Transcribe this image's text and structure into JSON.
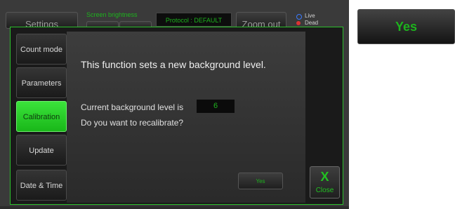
{
  "background": {
    "settings_label": "Settings",
    "brightness_label": "Screen brightness",
    "protocol_label": "Protocol : DEFAULT",
    "zoom_out_label": "Zoom out",
    "live_label": "Live",
    "dead_label": "Dead"
  },
  "sidebar": {
    "items": [
      {
        "label": "Count mode",
        "active": false
      },
      {
        "label": "Parameters",
        "active": false
      },
      {
        "label": "Calibration",
        "active": true
      },
      {
        "label": "Update",
        "active": false
      },
      {
        "label": "Date & Time",
        "active": false
      }
    ]
  },
  "dialog": {
    "heading": "This function sets a new background level.",
    "current_level_label": "Current background level is",
    "current_level_value": "6",
    "question": "Do you want to recalibrate?",
    "yes_label": "Yes",
    "close_icon": "X",
    "close_label": "Close"
  },
  "zoom_inset": {
    "yes_label": "Yes"
  },
  "colors": {
    "accent_green": "#1db31d",
    "active_tab": "#2bd02b",
    "frame_border": "#2bc02b"
  }
}
